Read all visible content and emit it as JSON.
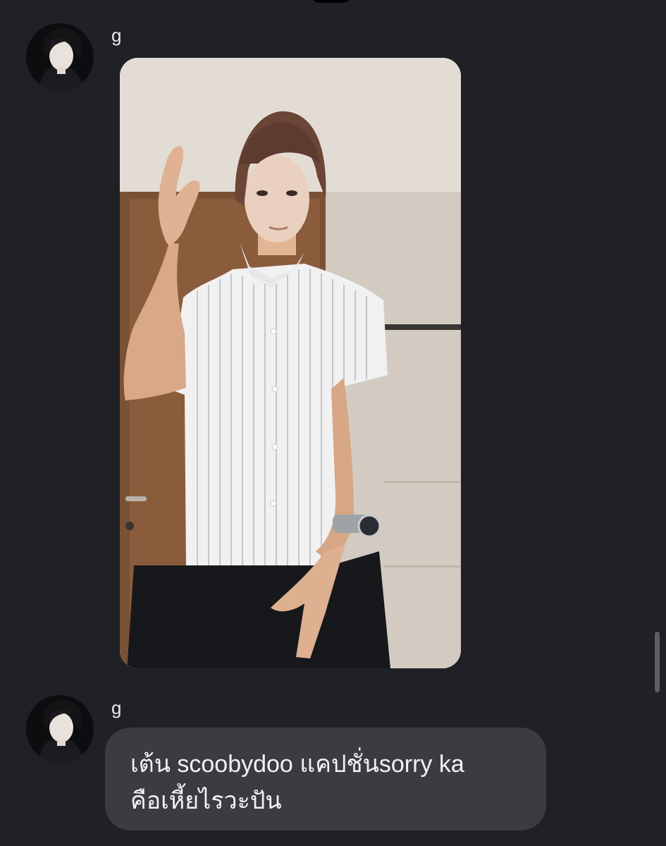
{
  "messages": [
    {
      "sender": "g",
      "type": "image",
      "avatar": "profile-photo"
    },
    {
      "sender": "g",
      "type": "text",
      "avatar": "profile-photo",
      "lines": [
        "เต้น scoobydoo แคปชั่นsorry ka",
        "คือเหี้ยไรวะปัน"
      ]
    }
  ],
  "colors": {
    "background": "#202126",
    "bubble": "#3b3c42",
    "text": "#f2f2f4"
  }
}
